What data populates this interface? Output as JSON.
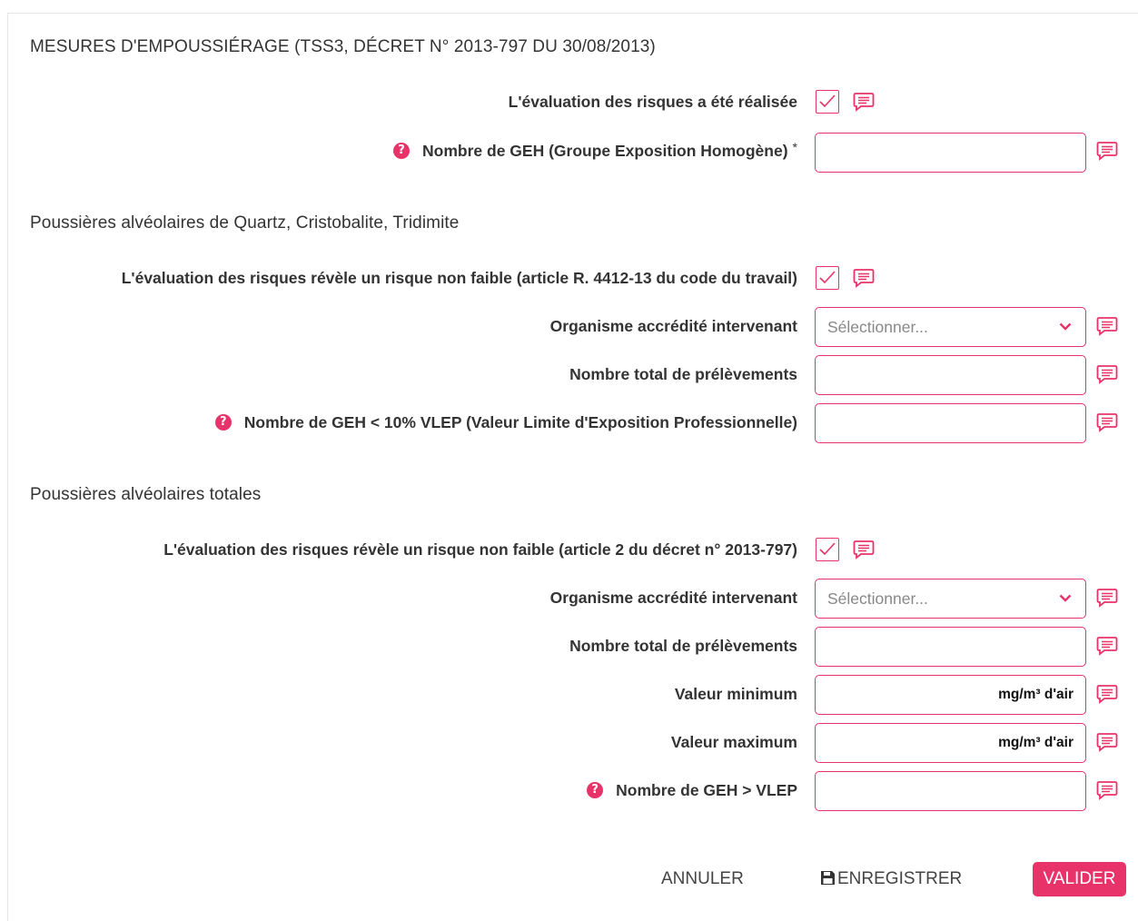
{
  "form": {
    "section_main_title": "MESURES D'EMPOUSSIÉRAGE (TSS3, DÉCRET N° 2013-797 DU 30/08/2013)",
    "eval_done_label": "L'évaluation des risques a été réalisée",
    "geh_count_label": "Nombre de GEH (Groupe Exposition Homogène)",
    "required_mark": "*",
    "help_glyph": "?",
    "geh_count_value": ""
  },
  "quartz": {
    "title": "Poussières alvéolaires de Quartz, Cristobalite, Tridimite",
    "risk_label": "L'évaluation des risques révèle un risque non faible (article R. 4412-13 du code du travail)",
    "org_label": "Organisme accrédité intervenant",
    "org_placeholder": "Sélectionner...",
    "samples_label": "Nombre total de prélèvements",
    "geh_low_label": "Nombre de GEH < 10% VLEP (Valeur Limite d'Exposition Professionnelle)"
  },
  "total": {
    "title": "Poussières alvéolaires totales",
    "risk_label": "L'évaluation des risques révèle un risque non faible (article 2 du décret n° 2013-797)",
    "org_label": "Organisme accrédité intervenant",
    "org_placeholder": "Sélectionner...",
    "samples_label": "Nombre total de prélèvements",
    "min_label": "Valeur minimum",
    "max_label": "Valeur maximum",
    "unit": "mg/m³ d'air",
    "geh_over_label": "Nombre de GEH > VLEP"
  },
  "actions": {
    "cancel": "ANNULER",
    "save": "ENREGISTRER",
    "submit": "VALIDER"
  },
  "colors": {
    "accent": "#e8336a"
  },
  "icons": {
    "comment": "comment-icon",
    "help": "question-circle-icon",
    "check": "check-icon",
    "save": "floppy-disk-icon",
    "chevron": "chevron-down-icon"
  }
}
